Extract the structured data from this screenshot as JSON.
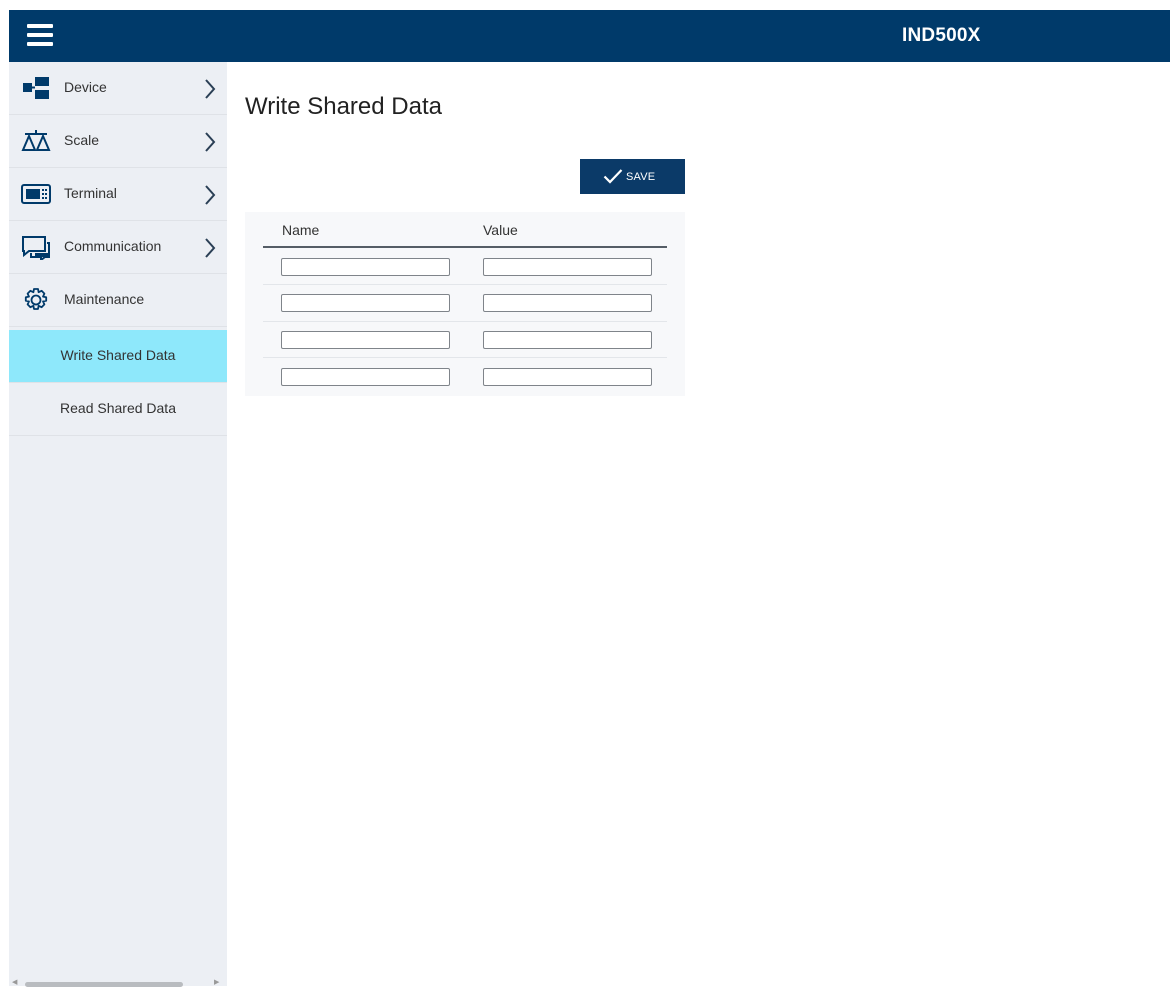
{
  "header": {
    "title": "IND500X"
  },
  "sidebar": {
    "items": [
      {
        "label": "Device",
        "icon": "device-icon",
        "has_children": true
      },
      {
        "label": "Scale",
        "icon": "scale-icon",
        "has_children": true
      },
      {
        "label": "Terminal",
        "icon": "terminal-icon",
        "has_children": true
      },
      {
        "label": "Communication",
        "icon": "communication-icon",
        "has_children": true
      },
      {
        "label": "Maintenance",
        "icon": "gear-icon",
        "has_children": false
      }
    ],
    "sub_items": [
      {
        "label": "Write Shared Data",
        "active": true
      },
      {
        "label": "Read Shared Data",
        "active": false
      }
    ]
  },
  "main": {
    "page_title": "Write Shared Data",
    "save_label": "SAVE",
    "table": {
      "columns": [
        "Name",
        "Value"
      ],
      "rows": [
        {
          "name": "",
          "value": ""
        },
        {
          "name": "",
          "value": ""
        },
        {
          "name": "",
          "value": ""
        },
        {
          "name": "",
          "value": ""
        }
      ]
    }
  },
  "colors": {
    "header_bg": "#003a6a",
    "sidebar_bg": "#eceff4",
    "active_item_bg": "#8ee8fb",
    "button_bg": "#0b3a68"
  }
}
